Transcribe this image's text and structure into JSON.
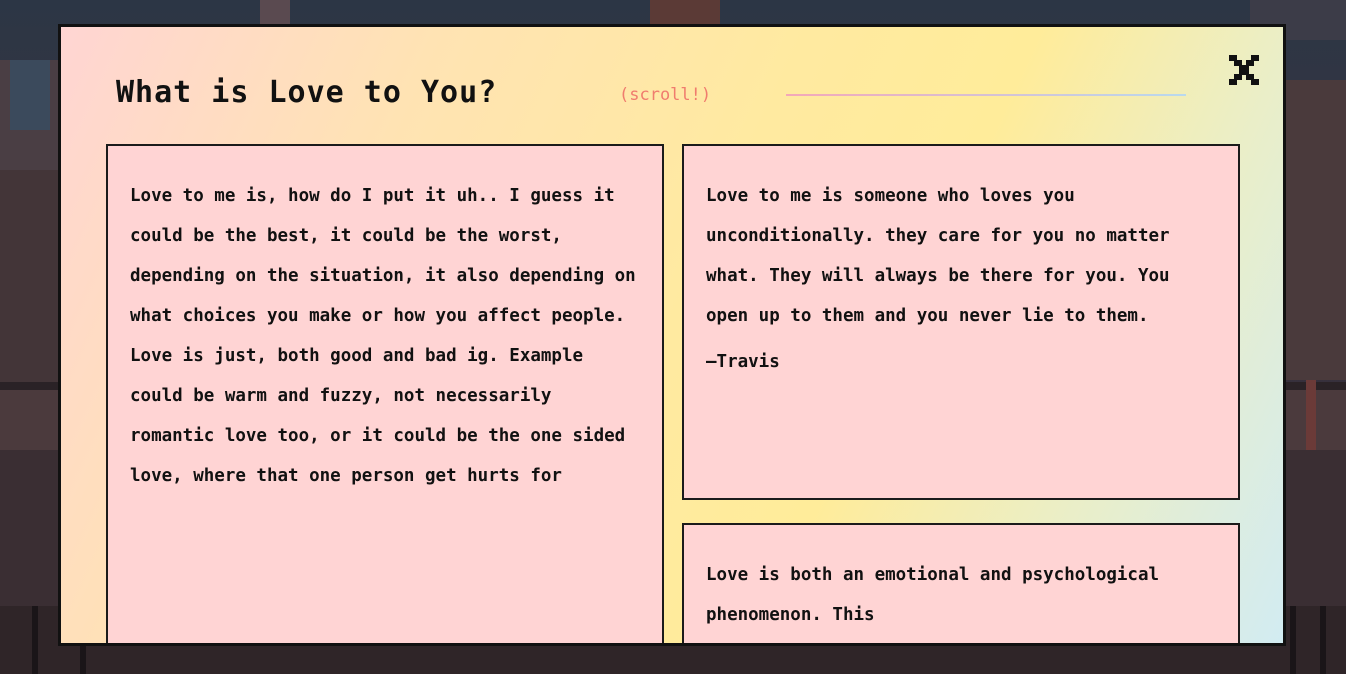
{
  "modal": {
    "title": "What is Love to You?",
    "hint": "(scroll!)",
    "close_icon": "close-x-icon"
  },
  "cards": [
    {
      "text": "Love to me is, how do I put it uh.. I guess it could be the best, it could be the worst, depending on the situation, it also depending on what choices you make or how you affect people. Love is just, both good and bad ig. Example could be warm and fuzzy, not necessarily romantic love too, or it could be the one sided love, where that one person get hurts for",
      "signature": ""
    },
    {
      "text": "Love to me is someone who loves you unconditionally. they care for you no matter what. They will always be there for you. You open up to them and you never lie to them.",
      "signature": "—Travis"
    },
    {
      "text": "Love is both an emotional and psychological phenomenon. This",
      "signature": ""
    }
  ],
  "colors": {
    "card_bg": "#ffd4d4",
    "hint": "#f07c6e",
    "border": "#111111"
  }
}
